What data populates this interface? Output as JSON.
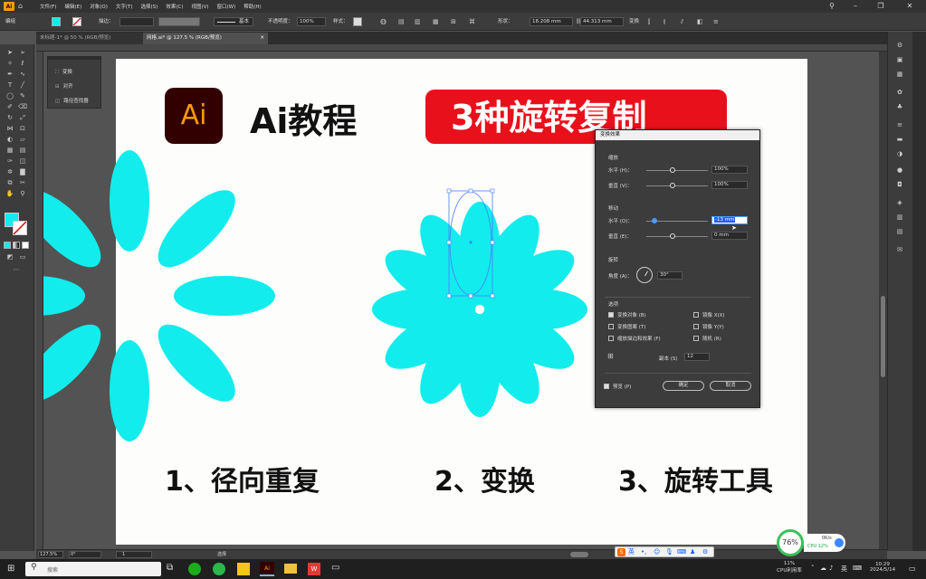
{
  "menu": {
    "logo": "Ai",
    "items": [
      "文件(F)",
      "编辑(E)",
      "对象(O)",
      "文字(T)",
      "选择(S)",
      "效果(C)",
      "视图(V)",
      "窗口(W)",
      "帮助(H)"
    ]
  },
  "controlbar": {
    "mode_label": "编组",
    "stroke_label": "描边：",
    "stroke_style": "基本",
    "opacity_label": "不透明度：",
    "opacity_value": "100%",
    "style_label": "样式：",
    "shape_label": "形状：",
    "width_value": "18.208 mm",
    "height_value": "44.313 mm",
    "transform_label": "变换"
  },
  "tabs": [
    {
      "label": "未标题-1* @ 50 % (RGB/预览)",
      "active": false
    },
    {
      "label": "网格.ai* @ 127.5 % (RGB/预览)",
      "active": true
    }
  ],
  "minipanel": {
    "items": [
      "变换",
      "对齐",
      "路径查找器"
    ]
  },
  "artboard": {
    "logo_text": "Ai",
    "heading": "Ai教程",
    "banner": "3种旋转复制",
    "captions": [
      "1、径向重复",
      "2、变换",
      "3、旋转工具"
    ],
    "petal_color": "#12ecec"
  },
  "dialog": {
    "title": "变换效果",
    "scale_section": "缩放",
    "scale_h_label": "水平 (H)：",
    "scale_h_value": "100%",
    "scale_v_label": "垂直 (V)：",
    "scale_v_value": "100%",
    "move_section": "移动",
    "move_h_label": "水平 (O)：",
    "move_h_value": "-13 mm",
    "move_v_label": "垂直 (E)：",
    "move_v_value": "0 mm",
    "rotate_section": "旋转",
    "angle_label": "角度 (A)：",
    "angle_value": "30°",
    "options_section": "选项",
    "opt_transform_objects": "变换对象 (B)",
    "opt_mirror_x": "镜像 X(X)",
    "opt_transform_patterns": "变换图案 (T)",
    "opt_mirror_y": "镜像 Y(Y)",
    "opt_scale_strokes": "缩放描边和效果 (F)",
    "opt_random": "随机 (R)",
    "copies_label": "副本 (S)",
    "copies_value": "12",
    "preview_label": "预览 (P)",
    "ok": "确定",
    "cancel": "取消"
  },
  "statusbar": {
    "zoom": "127.5%",
    "rotation": "0°",
    "artboard_num": "1",
    "tool": "选择"
  },
  "taskbar": {
    "search_placeholder": "搜索",
    "cpu_percent": "11%",
    "cpu_label": "CPU利用率",
    "time": "10:29",
    "date": "2024/5/14",
    "ime": "英",
    "lang": "英"
  },
  "widget": {
    "percent": "76%",
    "net": "0K/s",
    "cpu": "CPU 12%"
  }
}
